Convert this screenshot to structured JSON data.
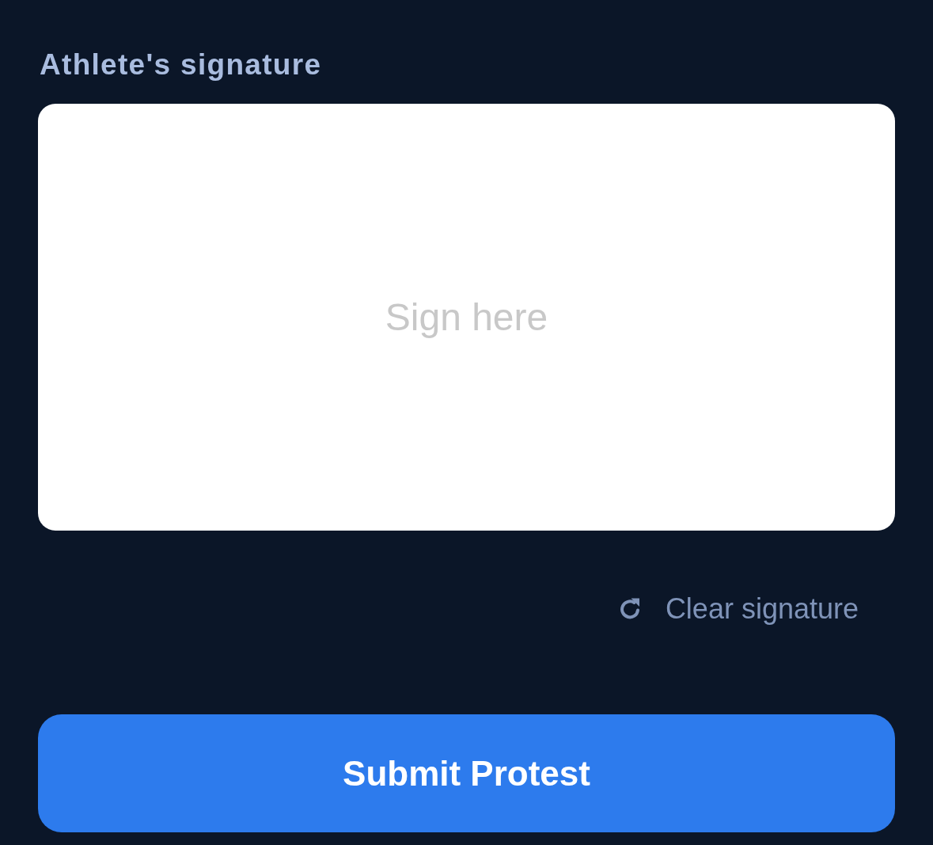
{
  "signature": {
    "label": "Athlete's signature",
    "pad": {
      "placeholder": "Sign here"
    },
    "clear_button": {
      "label": "Clear signature"
    }
  },
  "submit_button": {
    "label": "Submit Protest"
  }
}
